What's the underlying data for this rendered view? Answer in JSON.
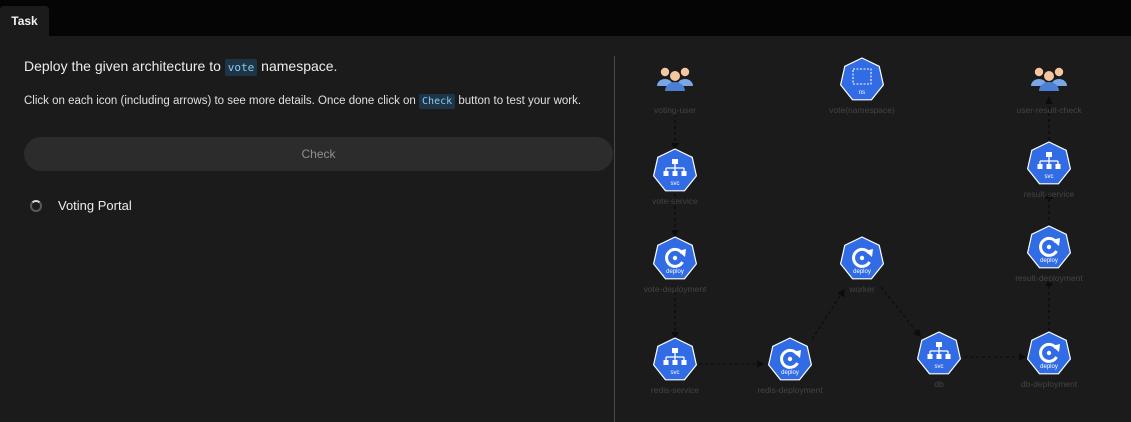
{
  "tab": {
    "label": "Task"
  },
  "task": {
    "heading_prefix": "Deploy the given architecture to",
    "heading_namespace": "vote",
    "heading_suffix": "namespace.",
    "instruction_prefix": "Click on each icon (including arrows) to see more details. Once done click on",
    "instruction_button_ref": "Check",
    "instruction_suffix": "button to test your work.",
    "check_button_label": "Check",
    "items": [
      {
        "label": "Voting Portal",
        "status": "loading"
      }
    ]
  },
  "diagram": {
    "nodes": [
      {
        "id": "voting-user",
        "label": "voting-user",
        "icon": "users-icon"
      },
      {
        "id": "vote-namespace",
        "label": "vote(namespace)",
        "icon": "namespace-icon",
        "badge": "ns"
      },
      {
        "id": "user-result-check",
        "label": "user-result-check",
        "icon": "users-icon"
      },
      {
        "id": "vote-service",
        "label": "vote-service",
        "icon": "service-icon",
        "badge": "svc"
      },
      {
        "id": "result-service",
        "label": "result-service",
        "icon": "service-icon",
        "badge": "svc"
      },
      {
        "id": "vote-deployment",
        "label": "vote-deployment",
        "icon": "deployment-icon",
        "badge": "deploy"
      },
      {
        "id": "worker",
        "label": "worker",
        "icon": "deployment-icon",
        "badge": "deploy"
      },
      {
        "id": "result-deployment",
        "label": "result-deployment",
        "icon": "deployment-icon",
        "badge": "deploy"
      },
      {
        "id": "redis-service",
        "label": "redis-service",
        "icon": "service-icon",
        "badge": "svc"
      },
      {
        "id": "redis-deployment",
        "label": "redis-deployment",
        "icon": "deployment-icon",
        "badge": "deploy"
      },
      {
        "id": "db",
        "label": "db",
        "icon": "service-icon",
        "badge": "svc"
      },
      {
        "id": "db-deployment",
        "label": "db-deployment",
        "icon": "deployment-icon",
        "badge": "deploy"
      }
    ],
    "edges": [
      {
        "from": "voting-user",
        "to": "vote-service"
      },
      {
        "from": "vote-service",
        "to": "vote-deployment"
      },
      {
        "from": "vote-deployment",
        "to": "redis-service"
      },
      {
        "from": "redis-service",
        "to": "redis-deployment"
      },
      {
        "from": "redis-deployment",
        "to": "worker"
      },
      {
        "from": "worker",
        "to": "db"
      },
      {
        "from": "db",
        "to": "db-deployment"
      },
      {
        "from": "db-deployment",
        "to": "result-deployment"
      },
      {
        "from": "result-deployment",
        "to": "result-service"
      },
      {
        "from": "result-service",
        "to": "user-result-check"
      }
    ],
    "colors": {
      "node_fill": "#326ce5",
      "node_glyph": "#ffffff",
      "label": "#444444",
      "edge": "#0c0c0c",
      "user_head": "#f5c7a0",
      "user_body": "#4a7fd4",
      "user_body_back": "#7aa6e8"
    }
  }
}
